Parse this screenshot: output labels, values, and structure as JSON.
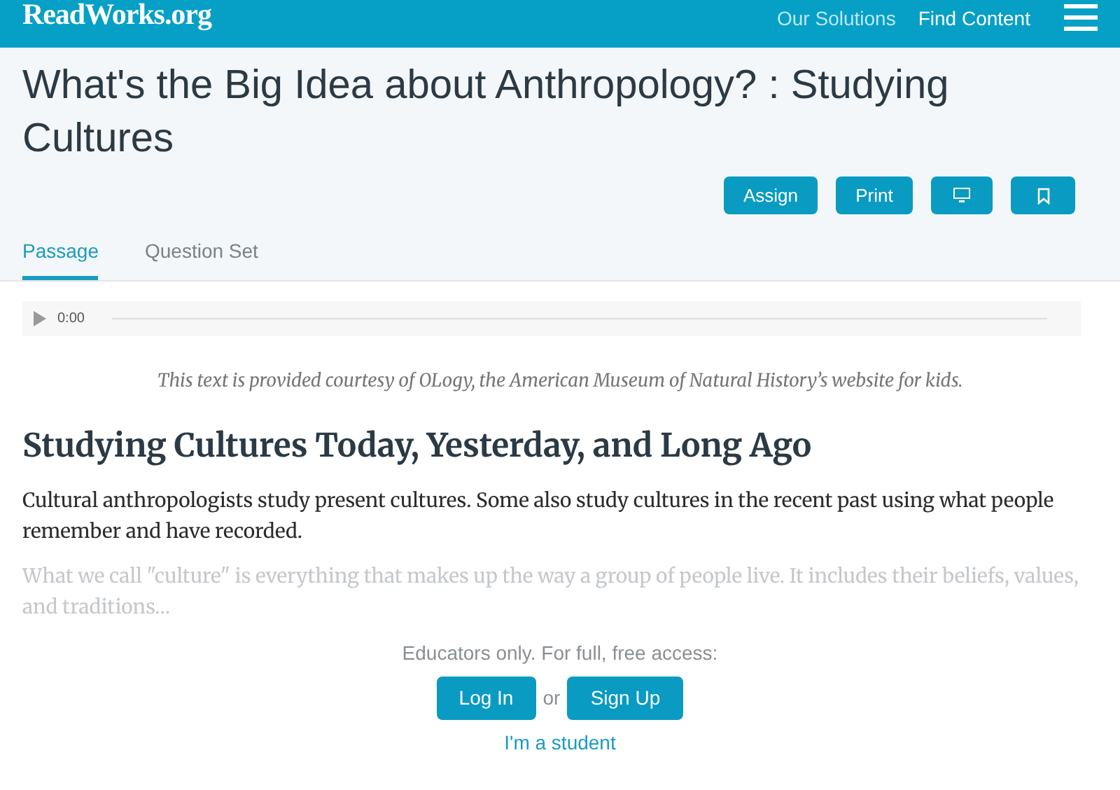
{
  "header": {
    "logo": "ReadWorks.org",
    "nav": [
      "Our Solutions",
      "Find Content"
    ]
  },
  "title": "What's the Big Idea about Anthropology? : Studying Cultures",
  "actions": [
    "Assign",
    "Print"
  ],
  "tabs": [
    {
      "label": "Passage",
      "selected": true
    },
    {
      "label": "Question Set",
      "selected": false
    }
  ],
  "audio": {
    "time": "0:00"
  },
  "courtesy": "This text is provided courtesy of OLogy, the American Museum of Natural History’s website for kids.",
  "heading": "Studying Cultures Today, Yesterday, and Long Ago",
  "paragraphs": [
    {
      "text": "Cultural anthropologists study present cultures. Some also study cultures in the recent past using what people remember and have recorded.",
      "faded": false
    },
    {
      "text": "What we call \"culture\" is everything that makes up the way a group of people live. It includes their beliefs, values, and traditions…",
      "faded": true
    }
  ],
  "gate": {
    "message": "Educators only. For full, free access:",
    "login": "Log In",
    "separator": "or",
    "signup": "Sign Up",
    "student": "I'm a student"
  }
}
